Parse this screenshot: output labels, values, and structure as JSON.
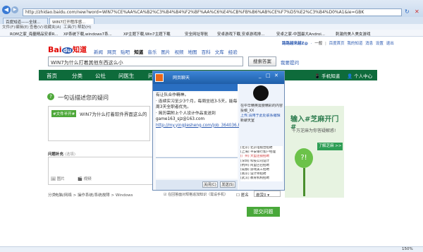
{
  "browser": {
    "url": "http://zhidao.baidu.com/new?word=WIN7%CE%AA%CA%B2%C3%B4%B4%F2%BF%AA%C6%E4%CB%FB%B6%AB%CE%F7%D5%E2%C3%B4%D0%A1&ie=GBK",
    "tabs": [
      "百度知道——全球...",
      "WIN7打开程序感..."
    ],
    "menu": [
      "文件(F)",
      "编辑(E)",
      "查看(V)",
      "收藏夹(A)",
      "工具(T)",
      "帮助(H)"
    ],
    "favorites": [
      "ROM之家_海量精品安卓R...",
      "XP系统下载,windows7系...",
      "XP主题下载,Win7主题下载",
      "安全网址导航",
      "安卓游戏下载,安卓游戏排...",
      "安卓之家-中国最大Androi...",
      "刺激的美人美女游戏"
    ],
    "zoom": "150%"
  },
  "header": {
    "logo_bai": "Bai",
    "logo_du": "du",
    "logo_zhidao": "知道",
    "links": [
      "新闻",
      "网页",
      "贴吧",
      "知道",
      "音乐",
      "图片",
      "视频",
      "地图",
      "百科",
      "文库",
      "经验"
    ],
    "user_links": [
      "路路越来越Z@",
      "·",
      "一般",
      "|",
      "百度首页",
      "我的知道",
      "消息",
      "设置",
      "退出"
    ],
    "search_value": "WIN7为什么打着其他东西这么小",
    "search_btn": "搜索答案",
    "ask_link": "我要提问"
  },
  "nav": {
    "items": [
      "首页",
      "分类",
      "公社",
      "问医生",
      "问"
    ],
    "right": [
      "手机知道",
      "个人中心"
    ]
  },
  "question": {
    "title": "一句话描述您的疑问",
    "tag": "#文件半开#",
    "text": "WIN7为什么打着软件界面这么的",
    "supplement_label": "问题补充",
    "supplement_hint": "(选填)",
    "picture": "图片",
    "video": "视频",
    "category_label": "分类",
    "category_path": "电脑/网络 > 操作系统/系统故障 > Windows",
    "notify": "在回答面对规格追加知识（需设手机）",
    "anon": "匿名",
    "bounty": "悬赏0",
    "submit": "提交问题"
  },
  "popup": {
    "title": "网页聊天",
    "lines": [
      "有让队合作精神。",
      "· 连续实习至少3个月，每周坐班3-5天，能每周3天全职者优先。",
      "· 简历需附上个人设计作品发送到",
      "game163_sjz@163.com",
      "http://my.yingjiesheng.com/job_364036.html"
    ],
    "btn_close": "关闭(C)",
    "btn_send": "发送(S)",
    "side_text": [
      "在中华精英需要精彩的内容，您可",
      "投稿_XX",
      "上传,请用于此处联系编辑",
      "新聊天室"
    ],
    "list": [
      "[北京] 北京电视台招聘",
      "[上海] 平安银行客户经理",
      "[广州] 大型连锁招聘",
      "[深圳] 科技公司设计",
      "[杭州] 阿里巴巴招聘",
      "[成都] 游戏美工招聘",
      "[南京] 设计师招聘",
      "[武汉] 教育机构招聘"
    ]
  },
  "ad": {
    "title": "输入#芝麻开门#",
    "sub": "千万芝麻为你答疑解惑!",
    "btn": "了解芝麻 >>",
    "q": "?!"
  },
  "status": {
    "zoom": "150%"
  }
}
